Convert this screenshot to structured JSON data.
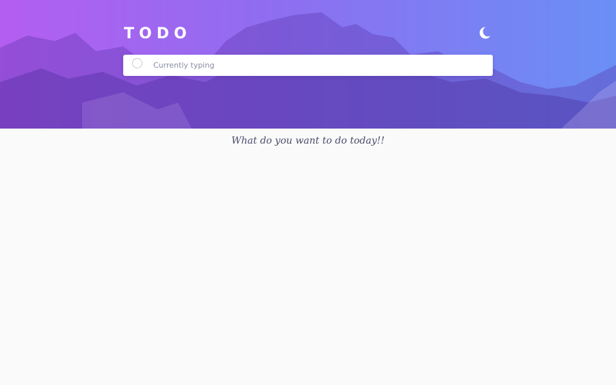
{
  "app": {
    "title": "TODO"
  },
  "header": {
    "theme_toggle_icon": "moon-icon"
  },
  "new_todo": {
    "value": "",
    "placeholder": "Currently typing"
  },
  "list": {
    "empty_message": "What do you want to do today!!"
  },
  "colors": {
    "gradient_start": "#b45ef0",
    "gradient_end": "#6a8ff5",
    "background": "#fafafa",
    "text_dark": "#494c6b",
    "placeholder": "#8a8da3"
  }
}
